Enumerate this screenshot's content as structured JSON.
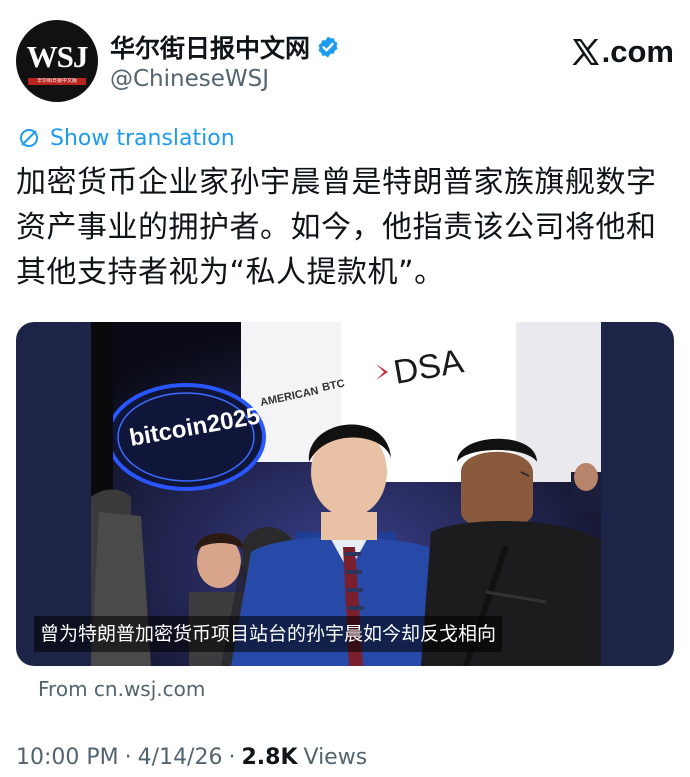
{
  "account": {
    "avatar_text": "WSJ",
    "avatar_subtext": "华尔街日报中文版",
    "display_name": "华尔街日报中文网",
    "handle": "@ChineseWSJ",
    "verified": true
  },
  "brand": {
    "site": ".com",
    "logo_icon": "x-logo-icon"
  },
  "translation": {
    "label": "Show translation",
    "icon": "globe-icon"
  },
  "tweet": {
    "text": "加密货币企业家孙宇晨曾是特朗普家族旗舰数字资产事业的拥护者。如今，他指责该公司将他和其他支持者视为“私人提款机”。"
  },
  "media": {
    "caption": "曾为特朗普加密货币项目站台的孙宇晨如今却反戈相向",
    "sign_bitcoin": "bitcoin2025",
    "sign_american": "AMERICAN",
    "sign_btc": "BTC",
    "sign_dsa": "DSA"
  },
  "source": {
    "label": "From cn.wsj.com"
  },
  "meta": {
    "time": "10:00 PM",
    "date": "4/14/26",
    "separator": "·",
    "views_count": "2.8K",
    "views_label": "Views"
  },
  "colors": {
    "link": "#1d9bf0",
    "verified": "#1d9bf0",
    "muted": "#536471",
    "media_bg": "#1e2447"
  }
}
